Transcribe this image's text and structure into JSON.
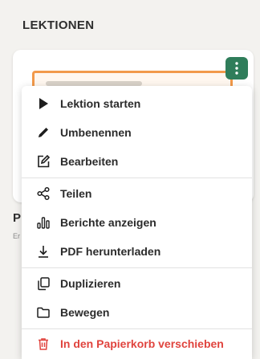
{
  "section": {
    "title": "LEKTIONEN"
  },
  "background": {
    "card_initial": "P",
    "card_sub": "Er"
  },
  "menu": {
    "items": [
      {
        "label": "Lektion starten",
        "icon": "play-icon"
      },
      {
        "label": "Umbenennen",
        "icon": "pencil-icon"
      },
      {
        "label": "Bearbeiten",
        "icon": "edit-icon"
      },
      {
        "label": "Teilen",
        "icon": "share-icon"
      },
      {
        "label": "Berichte anzeigen",
        "icon": "bar-chart-icon"
      },
      {
        "label": "PDF herunterladen",
        "icon": "download-icon"
      },
      {
        "label": "Duplizieren",
        "icon": "duplicate-icon"
      },
      {
        "label": "Bewegen",
        "icon": "folder-icon"
      },
      {
        "label": "In den Papierkorb verschieben",
        "icon": "trash-icon"
      }
    ]
  },
  "colors": {
    "accent_green": "#2f7d5a",
    "danger_red": "#e0443e",
    "thumb_border": "#f2994a"
  }
}
